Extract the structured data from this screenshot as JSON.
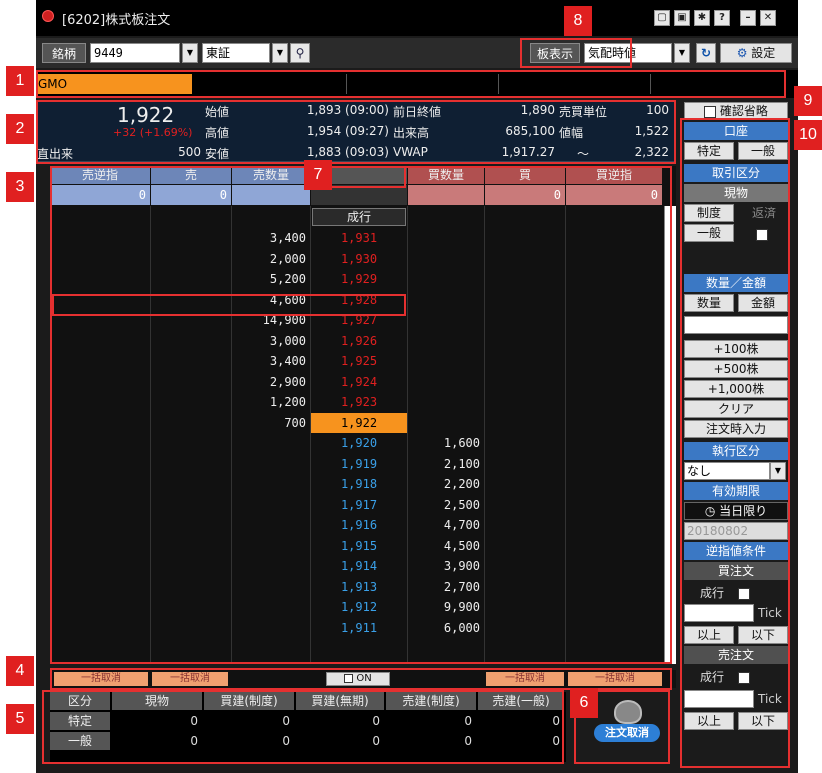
{
  "window": {
    "title": "[6202]株式板注文"
  },
  "toolbar": {
    "symbol_label": "銘柄",
    "symbol_value": "9449",
    "market_value": "東証",
    "board_display_label": "板表示",
    "board_mode_value": "気配時値",
    "settings_label": "設定"
  },
  "stock_name": "GMO",
  "info": {
    "price": "1,922",
    "change": "+32 (+1.69%)",
    "prev_volume_label": "直出来",
    "prev_volume": "500",
    "open_label": "始値",
    "open": "1,893 (09:00)",
    "high_label": "高値",
    "high": "1,954 (09:27)",
    "low_label": "安値",
    "low": "1,883 (09:03)",
    "prev_close_label": "前日終値",
    "prev_close": "1,890",
    "volume_label": "出来高",
    "volume": "685,100",
    "vwap_label": "VWAP",
    "vwap": "1,917.27",
    "unit_label": "売買単位",
    "unit": "100",
    "range_label": "値幅",
    "range_low": "1,522",
    "range_sep": "～",
    "range_high": "2,322"
  },
  "book": {
    "headers": [
      "売逆指",
      "売",
      "売数量",
      "",
      "買数量",
      "買",
      "買逆指"
    ],
    "totals": [
      "0",
      "0",
      "",
      "",
      "",
      "0",
      "0"
    ],
    "market_order": "成行",
    "rows": [
      {
        "sell_qty": "3,400",
        "price": "1,931",
        "buy_qty": ""
      },
      {
        "sell_qty": "2,000",
        "price": "1,930",
        "buy_qty": ""
      },
      {
        "sell_qty": "5,200",
        "price": "1,929",
        "buy_qty": ""
      },
      {
        "sell_qty": "4,600",
        "price": "1,928",
        "buy_qty": ""
      },
      {
        "sell_qty": "14,900",
        "price": "1,927",
        "buy_qty": ""
      },
      {
        "sell_qty": "3,000",
        "price": "1,926",
        "buy_qty": ""
      },
      {
        "sell_qty": "3,400",
        "price": "1,925",
        "buy_qty": ""
      },
      {
        "sell_qty": "2,900",
        "price": "1,924",
        "buy_qty": ""
      },
      {
        "sell_qty": "1,200",
        "price": "1,923",
        "buy_qty": ""
      },
      {
        "sell_qty": "700",
        "price": "1,922",
        "buy_qty": ""
      },
      {
        "sell_qty": "",
        "price": "1,920",
        "buy_qty": "1,600"
      },
      {
        "sell_qty": "",
        "price": "1,919",
        "buy_qty": "2,100"
      },
      {
        "sell_qty": "",
        "price": "1,918",
        "buy_qty": "2,200"
      },
      {
        "sell_qty": "",
        "price": "1,917",
        "buy_qty": "2,500"
      },
      {
        "sell_qty": "",
        "price": "1,916",
        "buy_qty": "4,700"
      },
      {
        "sell_qty": "",
        "price": "1,915",
        "buy_qty": "4,500"
      },
      {
        "sell_qty": "",
        "price": "1,914",
        "buy_qty": "3,900"
      },
      {
        "sell_qty": "",
        "price": "1,913",
        "buy_qty": "2,700"
      },
      {
        "sell_qty": "",
        "price": "1,912",
        "buy_qty": "9,900"
      },
      {
        "sell_qty": "",
        "price": "1,911",
        "buy_qty": "6,000"
      }
    ]
  },
  "bulk": {
    "cancel_label": "一括取消",
    "on_label": "ON"
  },
  "positions": {
    "headers": [
      "区分",
      "現物",
      "買建(制度)",
      "買建(無期)",
      "売建(制度)",
      "売建(一般)"
    ],
    "rows": [
      {
        "label": "特定",
        "values": [
          "0",
          "0",
          "0",
          "0",
          "0"
        ]
      },
      {
        "label": "一般",
        "values": [
          "0",
          "0",
          "0",
          "0",
          "0"
        ]
      }
    ]
  },
  "cancel_orders_label": "注文取消",
  "side": {
    "confirm_skip": "確認省略",
    "account": "口座",
    "tokutei": "特定",
    "ippan": "一般",
    "trade_type": "取引区分",
    "genbutsu": "現物",
    "seido": "制度",
    "hensai": "返済",
    "ippan2": "一般",
    "qty_amount": "数量／金額",
    "qty": "数量",
    "amount": "金額",
    "add100": "+100株",
    "add500": "+500株",
    "add1000": "+1,000株",
    "clear": "クリア",
    "input_on_order": "注文時入力",
    "exec_type": "執行区分",
    "exec_value": "なし",
    "expiry": "有効期限",
    "today_only": "当日限り",
    "date": "20180802",
    "stop_cond": "逆指値条件",
    "buy_order": "買注文",
    "market": "成行",
    "tick": "Tick",
    "above": "以上",
    "below": "以下",
    "sell_order": "売注文"
  },
  "badges": [
    "1",
    "2",
    "3",
    "4",
    "5",
    "6",
    "7",
    "8",
    "9",
    "10"
  ],
  "colors": {
    "orange": "#f7931e",
    "sell_header": "#6d86b8",
    "buy_header": "#b05050",
    "ask_price": "#e02020",
    "bid_price": "#3aa0e8",
    "side_header": "#3b78c4",
    "highlight": "#e53030"
  }
}
